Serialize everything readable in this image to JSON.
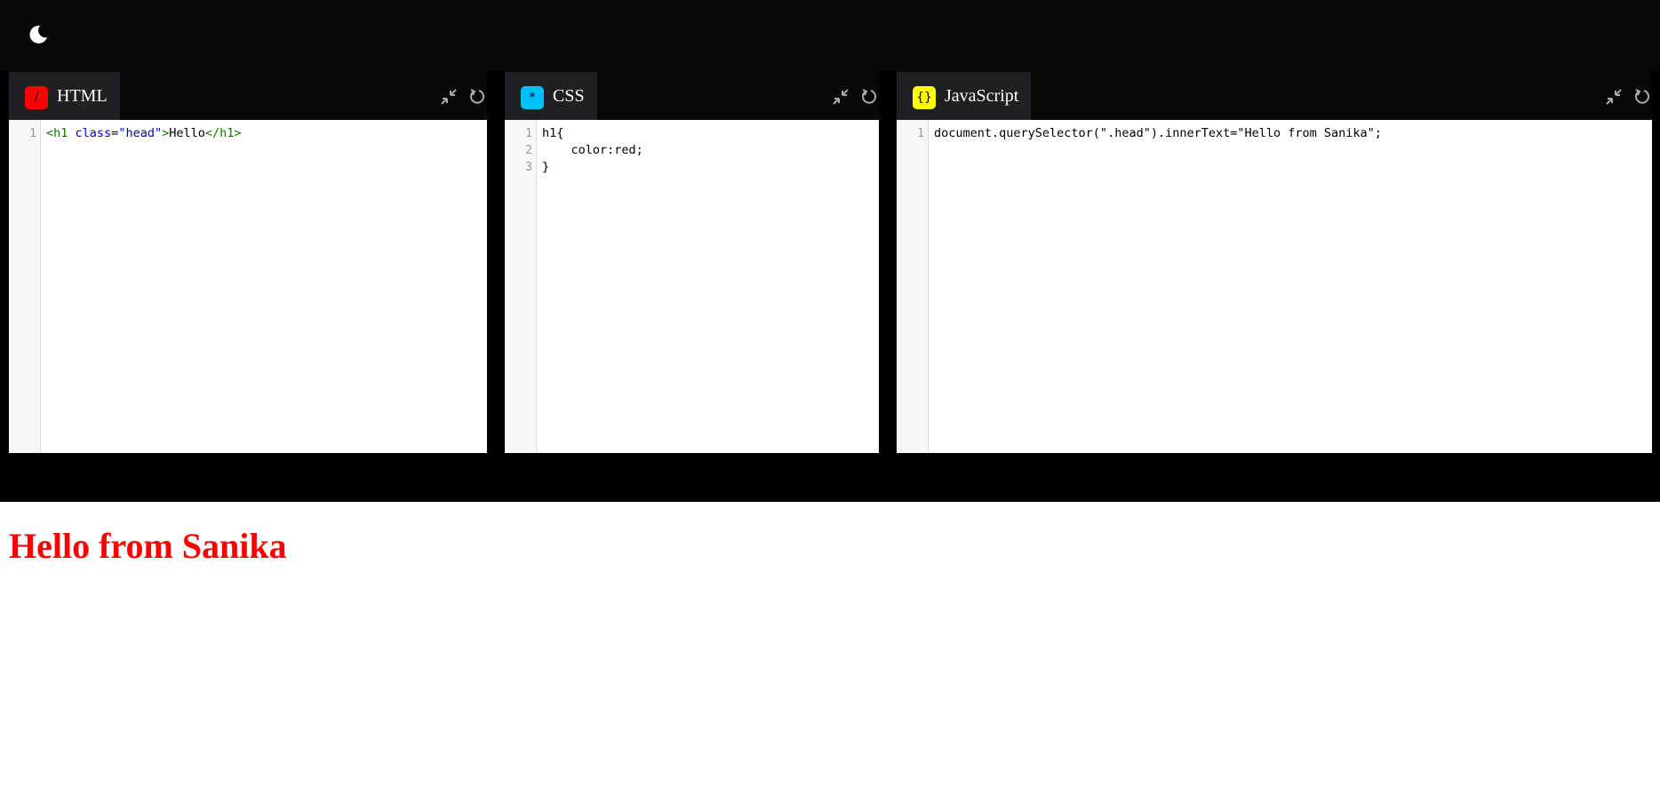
{
  "colors": {
    "html_badge": "#ff0000",
    "css_badge": "#00bfff",
    "js_badge": "#ffff00",
    "output_heading": "#ff0000"
  },
  "toolbar": {
    "theme_icon": "moon-icon"
  },
  "editors": {
    "html": {
      "label": "HTML",
      "badge_glyph": "/",
      "line_numbers": [
        "1"
      ],
      "code_lines": [
        "<h1 class=\"head\">Hello</h1>"
      ]
    },
    "css": {
      "label": "CSS",
      "badge_glyph": "*",
      "line_numbers": [
        "1",
        "2",
        "3"
      ],
      "code_lines": [
        "h1{",
        "    color:red;",
        "}"
      ]
    },
    "js": {
      "label": "JavaScript",
      "badge_glyph": "{}",
      "line_numbers": [
        "1"
      ],
      "code_lines": [
        "document.querySelector(\".head\").innerText=\"Hello from Sanika\";"
      ]
    }
  },
  "header_icons": [
    "minimize-icon",
    "reset-icon"
  ],
  "output": {
    "heading": "Hello from Sanika"
  }
}
